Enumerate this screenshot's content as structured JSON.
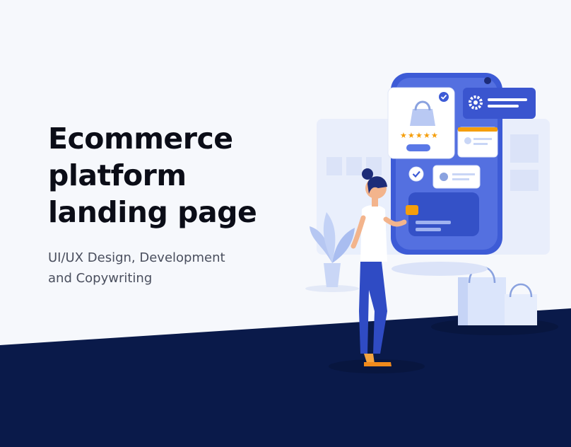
{
  "hero": {
    "title_lines": [
      "Ecommerce",
      "platform",
      "landing page"
    ],
    "subtitle_lines": [
      "UI/UX Design, Development",
      "and Copywriting"
    ]
  },
  "illustration": {
    "rating_stars": 5,
    "icons": [
      "product-bag-icon",
      "check-badge-icon",
      "gear-icon",
      "shopping-bags-icon",
      "potted-plant-icon"
    ]
  },
  "colors": {
    "background": "#f6f8fc",
    "footer_navy": "#0a1a4a",
    "accent_blue": "#3a5bd9",
    "star_orange": "#f59e0b"
  }
}
